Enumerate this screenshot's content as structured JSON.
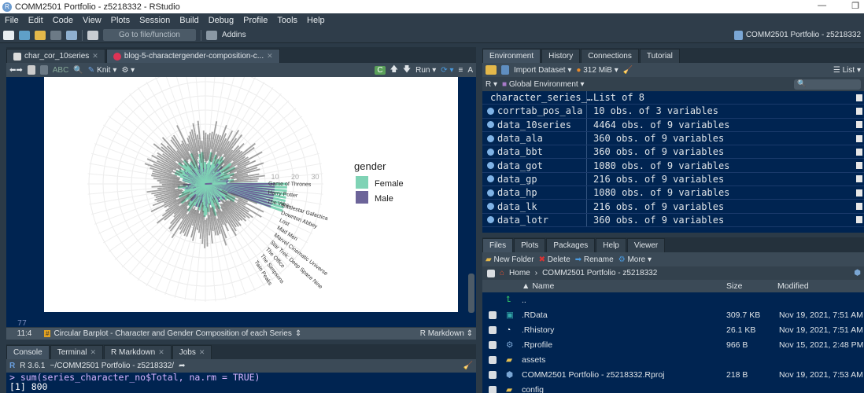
{
  "window": {
    "title": "COMM2501 Portfolio - z5218332 - RStudio",
    "restore": "❐",
    "close": "✕",
    "minimize": "—"
  },
  "menu": [
    "File",
    "Edit",
    "Code",
    "View",
    "Plots",
    "Session",
    "Build",
    "Debug",
    "Profile",
    "Tools",
    "Help"
  ],
  "toolbar": {
    "goto_placeholder": "Go to file/function",
    "addins": "Addins",
    "project": "COMM2501 Portfolio - z5218332"
  },
  "editor": {
    "tabs": [
      {
        "label": "char_cor_10series"
      },
      {
        "label": "blog-5-charactergender-composition-c..."
      }
    ],
    "knit": "Knit",
    "run": "Run",
    "line_number": "77",
    "cursor": "11:4",
    "section": "Circular Barplot - Character and Gender Composition of each Series",
    "mode": "R Markdown"
  },
  "plot": {
    "legend_title": "gender",
    "legend": [
      {
        "label": "Female",
        "color": "#7fd3b5"
      },
      {
        "label": "Male",
        "color": "#6c6499"
      }
    ],
    "ticks": [
      "10",
      "20",
      "30"
    ],
    "labels": [
      "Game of Thrones",
      "Harry Potter",
      "The Wire",
      "Battlestar Galactica",
      "Downton Abbey",
      "Lost",
      "Mad Men",
      "Marvel Cinematic Universe",
      "Star Trek: Deep Space Nine",
      "The Office",
      "The Simpsons",
      "Twin Peaks"
    ]
  },
  "console": {
    "tabs": [
      "Console",
      "Terminal",
      "R Markdown",
      "Jobs"
    ],
    "version": "R 3.6.1",
    "path": "~/COMM2501 Portfolio - z5218332/",
    "lines": [
      "> sum(series_character_no$Total, na.rm = TRUE)",
      "[1] 800"
    ]
  },
  "environment": {
    "tabs": [
      "Environment",
      "History",
      "Connections",
      "Tutorial"
    ],
    "import": "Import Dataset",
    "memory": "312 MiB",
    "view": "List",
    "lang": "R",
    "scope": "Global Environment",
    "rows": [
      {
        "name": "character_series_…",
        "value": "List of  8"
      },
      {
        "name": "corrtab_pos_ala",
        "value": "10 obs. of 3 variables"
      },
      {
        "name": "data_10series",
        "value": "4464 obs. of 9 variables"
      },
      {
        "name": "data_ala",
        "value": "360 obs. of 9 variables"
      },
      {
        "name": "data_bbt",
        "value": "360 obs. of 9 variables"
      },
      {
        "name": "data_got",
        "value": "1080 obs. of 9 variables"
      },
      {
        "name": "data_gp",
        "value": "216 obs. of 9 variables"
      },
      {
        "name": "data_hp",
        "value": "1080 obs. of 9 variables"
      },
      {
        "name": "data_lk",
        "value": "216 obs. of 9 variables"
      },
      {
        "name": "data_lotr",
        "value": "360 obs. of 9 variables"
      }
    ]
  },
  "files": {
    "tabs": [
      "Files",
      "Plots",
      "Packages",
      "Help",
      "Viewer"
    ],
    "new_folder": "New Folder",
    "delete": "Delete",
    "rename": "Rename",
    "more": "More",
    "breadcrumb_home": "Home",
    "breadcrumb_dir": "COMM2501 Portfolio - z5218332",
    "columns": [
      "Name",
      "Size",
      "Modified"
    ],
    "up": "..",
    "rows": [
      {
        "name": ".RData",
        "size": "309.7 KB",
        "modified": "Nov 19, 2021, 7:51 AM",
        "icon": "rdata"
      },
      {
        "name": ".Rhistory",
        "size": "26.1 KB",
        "modified": "Nov 19, 2021, 7:51 AM",
        "icon": "history"
      },
      {
        "name": ".Rprofile",
        "size": "966 B",
        "modified": "Nov 15, 2021, 2:48 PM",
        "icon": "gear"
      },
      {
        "name": "assets",
        "size": "",
        "modified": "",
        "icon": "folder"
      },
      {
        "name": "COMM2501 Portfolio - z5218332.Rproj",
        "size": "218 B",
        "modified": "Nov 19, 2021, 7:53 AM",
        "icon": "rproj"
      },
      {
        "name": "config",
        "size": "",
        "modified": "",
        "icon": "folder"
      }
    ]
  }
}
